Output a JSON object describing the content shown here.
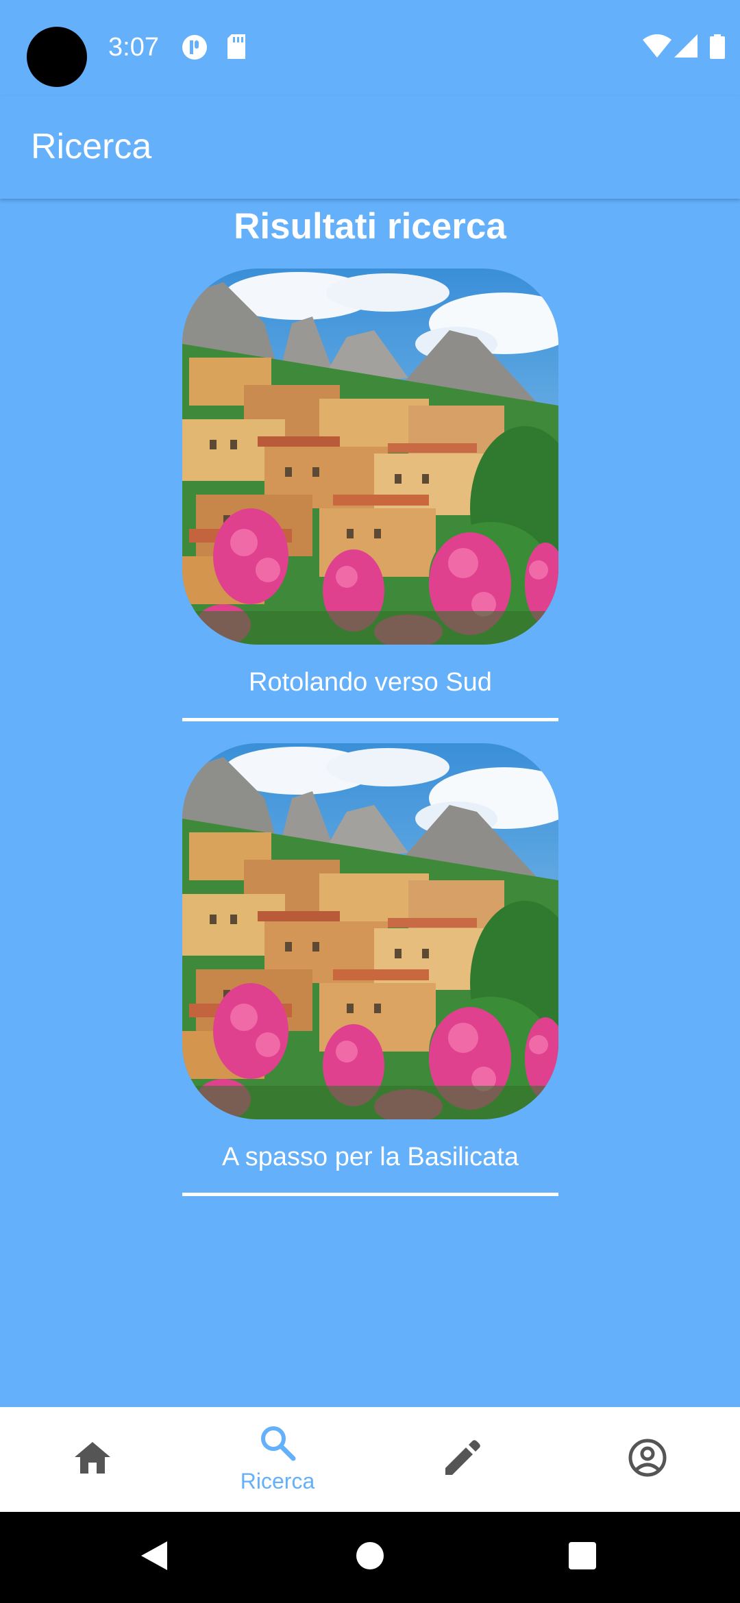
{
  "status_bar": {
    "time": "3:07",
    "icons": [
      "notification-icon",
      "sd-card-icon",
      "wifi-icon",
      "signal-icon",
      "battery-icon"
    ]
  },
  "app_bar": {
    "title": "Ricerca"
  },
  "content": {
    "heading": "Risultati ricerca",
    "results": [
      {
        "title": "Rotolando verso Sud"
      },
      {
        "title": "A spasso per la Basilicata"
      }
    ]
  },
  "bottom_nav": {
    "items": [
      {
        "icon": "home-icon",
        "label": "",
        "active": false
      },
      {
        "icon": "search-icon",
        "label": "Ricerca",
        "active": true
      },
      {
        "icon": "edit-icon",
        "label": "",
        "active": false
      },
      {
        "icon": "account-icon",
        "label": "",
        "active": false
      }
    ]
  },
  "colors": {
    "primary": "#64b0fb",
    "inactive_icon": "#555555",
    "nav_background": "#ffffff"
  }
}
